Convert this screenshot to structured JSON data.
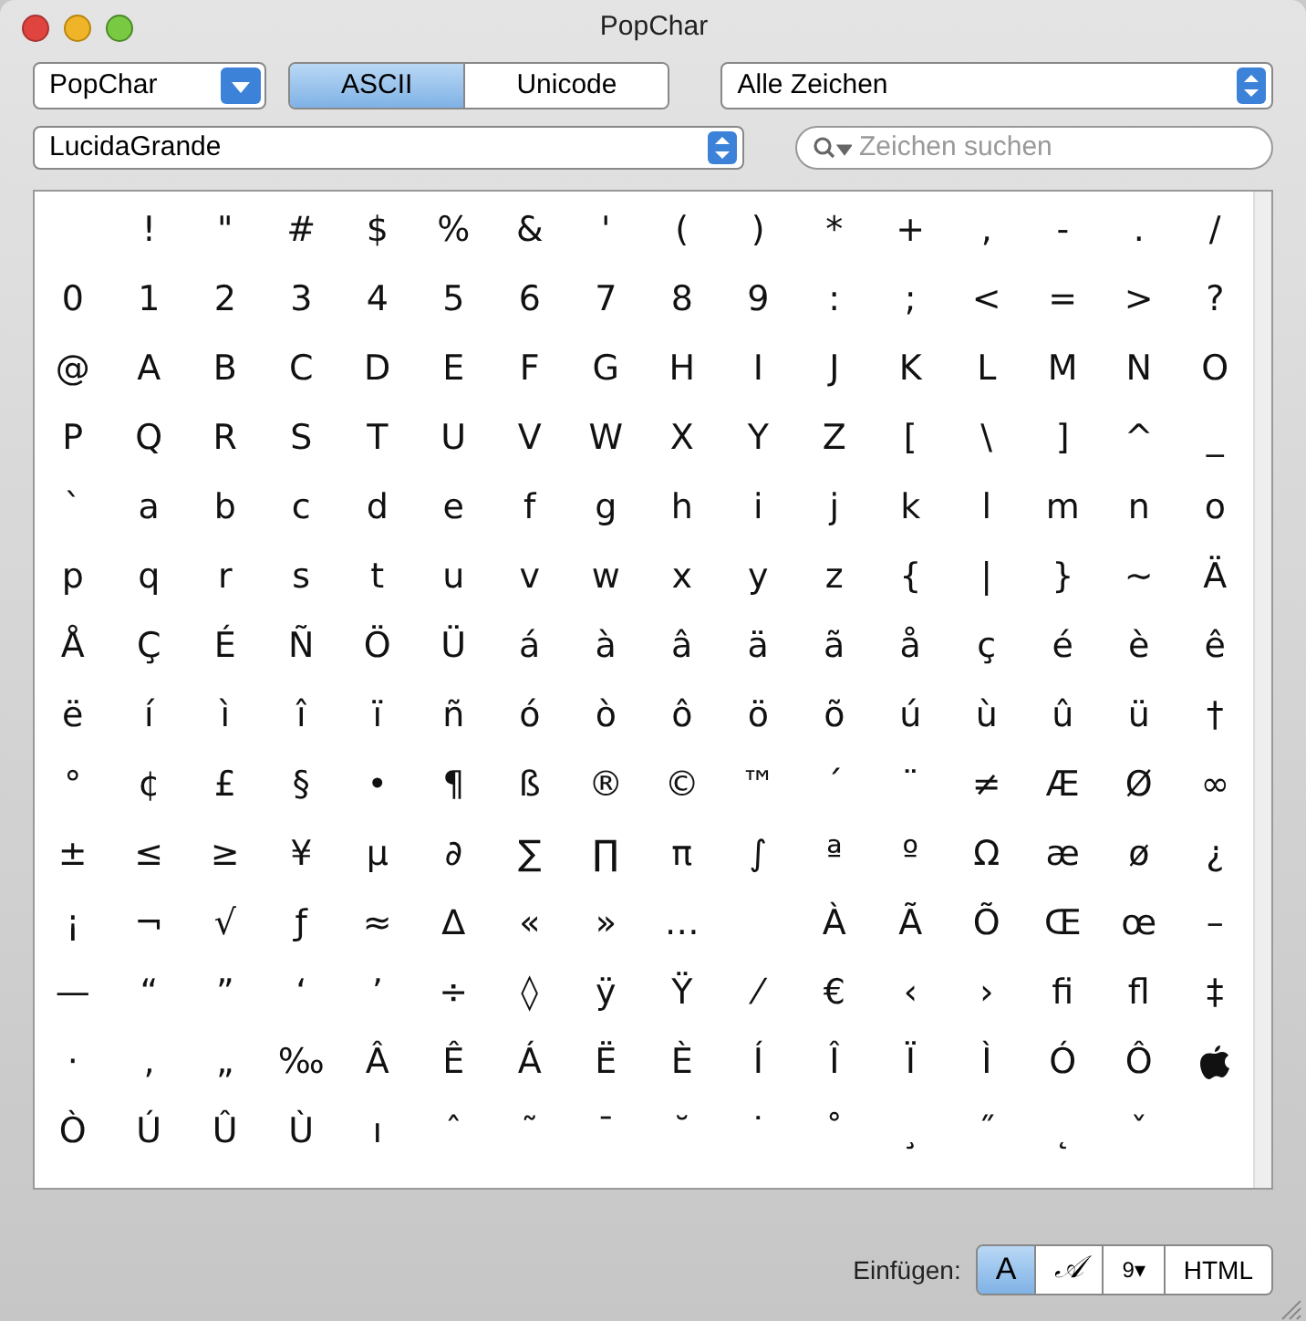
{
  "window": {
    "title": "PopChar"
  },
  "toolbar": {
    "family_menu": {
      "label": "PopChar"
    },
    "modes": [
      {
        "label": "ASCII",
        "selected": true
      },
      {
        "label": "Unicode",
        "selected": false
      }
    ],
    "filter_menu": {
      "label": "Alle Zeichen"
    },
    "font_menu": {
      "label": "LucidaGrande"
    },
    "search": {
      "placeholder": "Zeichen suchen"
    }
  },
  "grid": {
    "rows": [
      [
        {
          "kind": "blank"
        },
        "!",
        "\"",
        "#",
        "$",
        "%",
        "&",
        "'",
        "(",
        ")",
        "*",
        "+",
        ",",
        "-",
        ".",
        "/"
      ],
      [
        "0",
        "1",
        "2",
        "3",
        "4",
        "5",
        "6",
        "7",
        "8",
        "9",
        ":",
        ";",
        "<",
        "=",
        ">",
        "?"
      ],
      [
        "@",
        "A",
        "B",
        "C",
        "D",
        "E",
        "F",
        "G",
        "H",
        "I",
        "J",
        "K",
        "L",
        "M",
        "N",
        "O"
      ],
      [
        "P",
        "Q",
        "R",
        "S",
        "T",
        "U",
        "V",
        "W",
        "X",
        "Y",
        "Z",
        "[",
        "\\",
        "]",
        "^",
        "_"
      ],
      [
        "`",
        "a",
        "b",
        "c",
        "d",
        "e",
        "f",
        "g",
        "h",
        "i",
        "j",
        "k",
        "l",
        "m",
        "n",
        "o"
      ],
      [
        "p",
        "q",
        "r",
        "s",
        "t",
        "u",
        "v",
        "w",
        "x",
        "y",
        "z",
        "{",
        "|",
        "}",
        "~",
        "Ä"
      ],
      [
        "Å",
        "Ç",
        "É",
        "Ñ",
        "Ö",
        "Ü",
        "á",
        "à",
        "â",
        "ä",
        "ã",
        "å",
        "ç",
        "é",
        "è",
        "ê"
      ],
      [
        "ë",
        "í",
        "ì",
        "î",
        "ï",
        "ñ",
        "ó",
        "ò",
        "ô",
        "ö",
        "õ",
        "ú",
        "ù",
        "û",
        "ü",
        "†"
      ],
      [
        "°",
        "¢",
        "£",
        "§",
        "•",
        "¶",
        "ß",
        "®",
        "©",
        "™",
        "´",
        "¨",
        "≠",
        "Æ",
        "Ø",
        "∞"
      ],
      [
        "±",
        "≤",
        "≥",
        "¥",
        "µ",
        "∂",
        "∑",
        "∏",
        "π",
        "∫",
        "ª",
        "º",
        "Ω",
        "æ",
        "ø",
        "¿"
      ],
      [
        "¡",
        "¬",
        "√",
        "ƒ",
        "≈",
        "∆",
        "«",
        "»",
        "…",
        {
          "kind": "blank"
        },
        "À",
        "Ã",
        "Õ",
        "Œ",
        "œ",
        "–"
      ],
      [
        "—",
        "“",
        "”",
        "‘",
        "’",
        "÷",
        "◊",
        "ÿ",
        "Ÿ",
        "⁄",
        "€",
        "‹",
        "›",
        "ﬁ",
        "ﬂ",
        "‡"
      ],
      [
        "·",
        "‚",
        "„",
        "‰",
        "Â",
        "Ê",
        "Á",
        "Ë",
        "È",
        "Í",
        "Î",
        "Ï",
        "Ì",
        "Ó",
        "Ô",
        {
          "kind": "logo"
        }
      ],
      [
        "Ò",
        "Ú",
        "Û",
        "Ù",
        "ı",
        "ˆ",
        "˜",
        "¯",
        "˘",
        "˙",
        "˚",
        "¸",
        "˝",
        "˛",
        "ˇ"
      ]
    ]
  },
  "insert_bar": {
    "label": "Einfügen:",
    "options": [
      {
        "kind": "plain",
        "label": "A",
        "selected": true
      },
      {
        "kind": "script",
        "label": "𝒜",
        "selected": false
      },
      {
        "kind": "code",
        "label": "9▾",
        "selected": false
      },
      {
        "kind": "html",
        "label": "HTML",
        "selected": false
      }
    ]
  }
}
